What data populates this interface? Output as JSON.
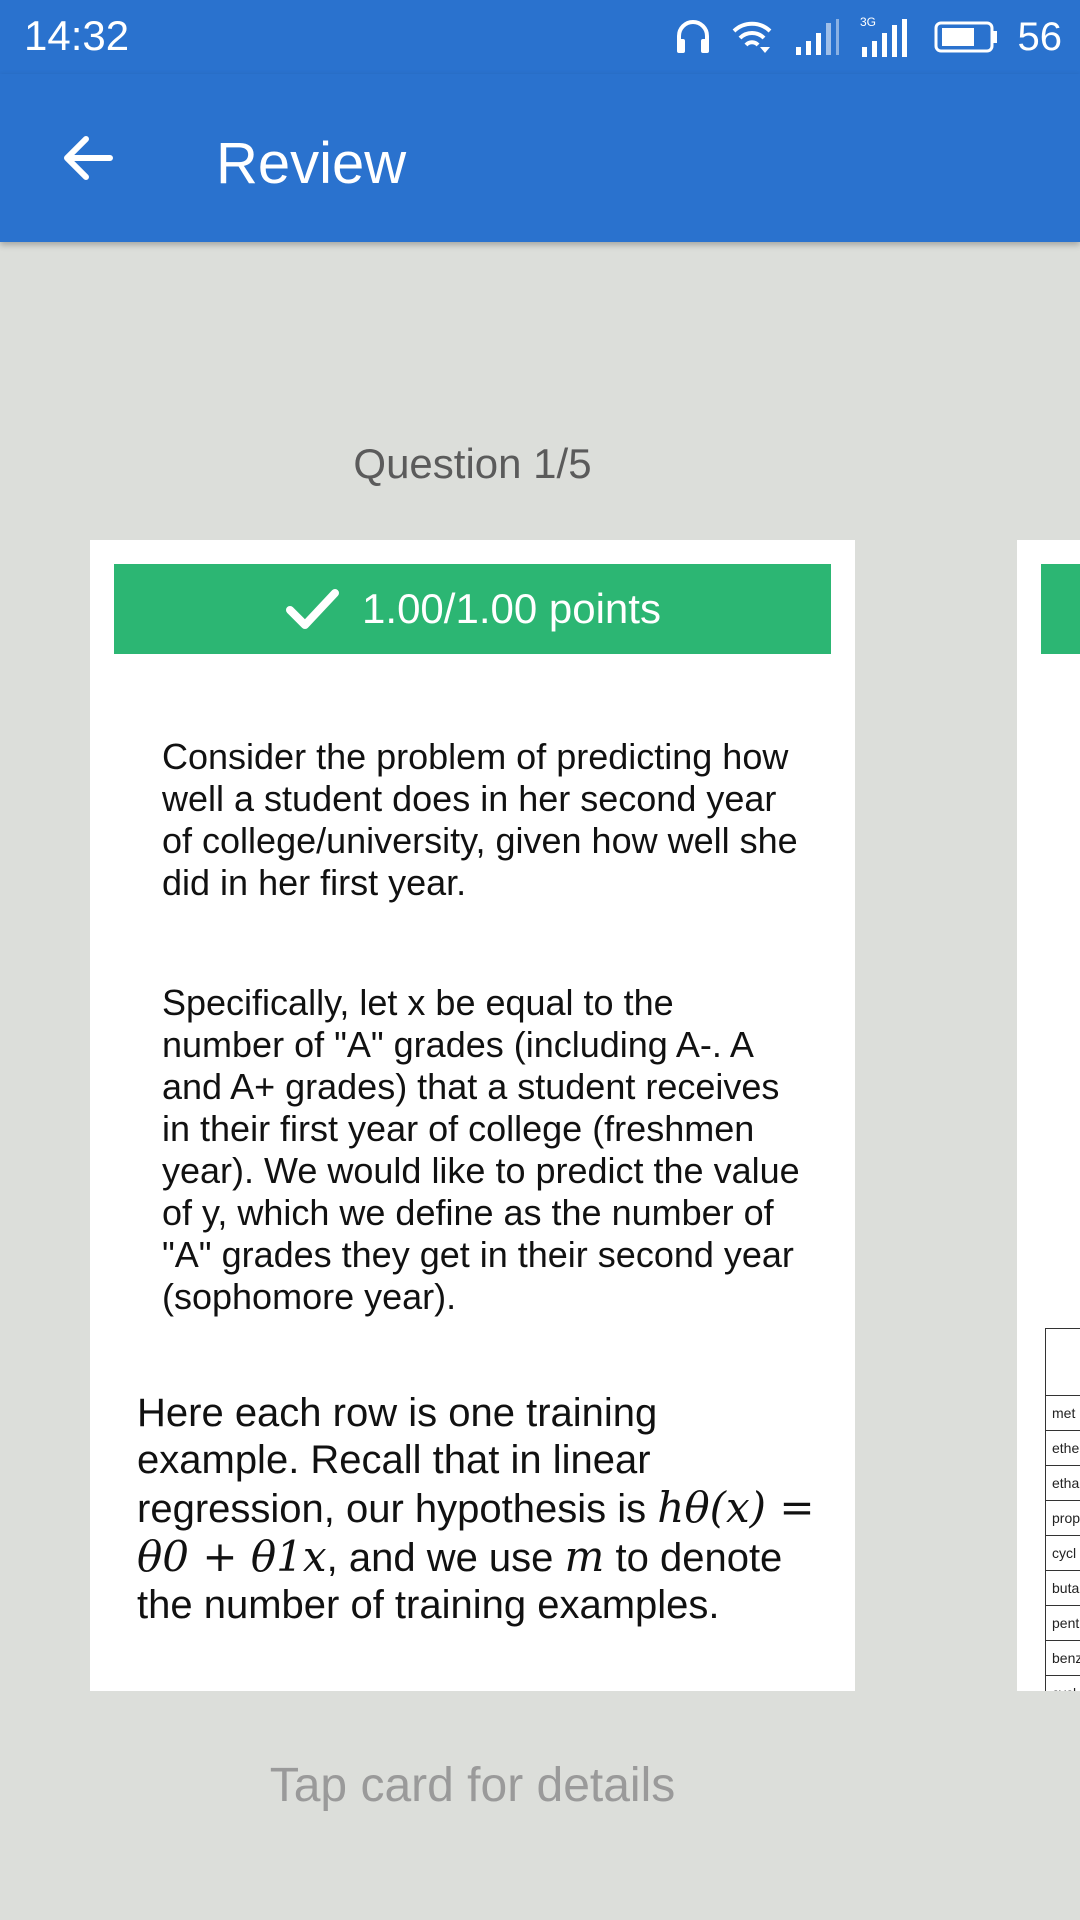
{
  "status_bar": {
    "time": "14:32",
    "network_label": "3G",
    "battery": "56",
    "icons": [
      "headphones-icon",
      "wifi-icon",
      "signal-icon",
      "signal-3g-icon",
      "battery-icon"
    ]
  },
  "app_bar": {
    "title": "Review",
    "back_icon": "arrow-left-icon"
  },
  "question": {
    "counter": "Question 1/5",
    "score": "1.00/1.00 points",
    "paragraph1": "Consider the problem of predicting how well a student does in her second year of college/university, given how well she did in her first year.",
    "paragraph2": "Specifically, let x be equal to the number of \"A\" grades (including A-. A and A+ grades) that a student receives in their first year of college (freshmen year). We would like to predict the value of y, which we define as the number of \"A\" grades they get in their second year (sophomore year).",
    "paragraph3_before": "Here each row is one training example. Recall that in linear regression, our hypothesis is ",
    "formula": "hθ(x) = θ0 + θ1x",
    "paragraph3_mid": ", and we use ",
    "m_symbol": "m",
    "paragraph3_after": " to denote the number of training examples."
  },
  "next_card_table_rows": [
    "met",
    "ethe",
    "etha",
    "prop",
    "cycl",
    "buta",
    "pent",
    "benz",
    "cycl"
  ],
  "hint": "Tap card for details",
  "colors": {
    "primary": "#2a72ce",
    "success": "#2cb673",
    "background": "#dcdeda"
  }
}
